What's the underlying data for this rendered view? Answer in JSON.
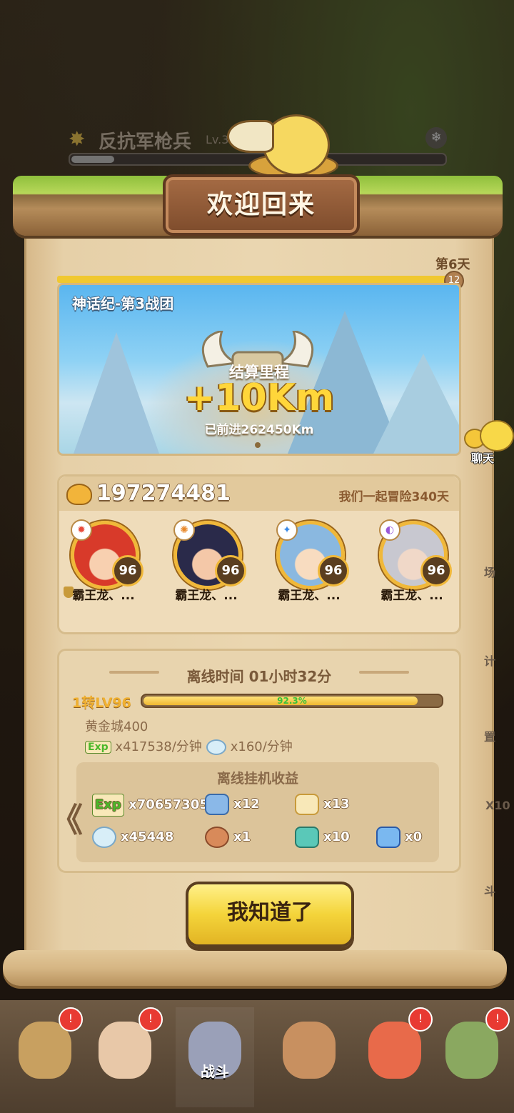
{
  "background": {
    "enemy_name": "反抗军枪兵",
    "enemy_level": "Lv.3",
    "snow_icon": "snowflake-icon"
  },
  "dialog": {
    "title": "欢迎回来",
    "stage_tag": "第6天",
    "stage_badge": "12",
    "map": {
      "title": "神话纪-第3战团",
      "settle_label": "结算里程",
      "gain": "+10Km",
      "advanced": "已前进262450Km"
    },
    "team": {
      "power": "197274481",
      "days": "我们一起冒险340天",
      "heroes": [
        {
          "name": "霸王龙、...",
          "level": "96",
          "element_color": "#e84a3a",
          "hair": "#d83a2a",
          "skin": "#f8d0b0",
          "element_icon": "fire-element-icon"
        },
        {
          "name": "霸王龙、...",
          "level": "96",
          "element_color": "#e8882a",
          "hair": "#2a2a4a",
          "skin": "#f4c8a8",
          "element_icon": "fire-element-icon"
        },
        {
          "name": "霸王龙、...",
          "level": "96",
          "element_color": "#3a8ae8",
          "hair": "#8ab8e0",
          "skin": "#f8dcc0",
          "element_icon": "ice-element-icon"
        },
        {
          "name": "霸王龙、...",
          "level": "96",
          "element_color": "#9a5ad8",
          "hair": "#c8c8d0",
          "skin": "#f0d8c8",
          "element_icon": "shadow-element-icon"
        }
      ]
    },
    "offline": {
      "time_text": "离线时间 01小时32分",
      "level_label": "1转LV96",
      "xp_percent": "92.3%",
      "xp_fraction": 0.923,
      "city": "黄金城400",
      "exp_tag": "Exp",
      "exp_rate": "x417538/分钟",
      "gem_rate": "x160/分钟",
      "rewards_title": "离线挂机收益",
      "rewards": [
        {
          "icon": "exp-icon",
          "amount": "x70657305"
        },
        {
          "icon": "equipment-box-icon",
          "amount": "x12"
        },
        {
          "icon": "torch-icon",
          "amount": "x13"
        },
        {
          "icon": "diamond-icon",
          "amount": "x45448"
        },
        {
          "icon": "meat-icon",
          "amount": "x1"
        },
        {
          "icon": "green-stone-icon",
          "amount": "x10"
        },
        {
          "icon": "blue-crystal-icon",
          "amount": "x0"
        }
      ],
      "prev_arrow": "《"
    },
    "confirm_label": "我知道了"
  },
  "side": {
    "chat_label": "聊天",
    "frag1": "场",
    "frag2": "计",
    "frag3": "置",
    "frag4": "X10",
    "frag5": "斗"
  },
  "nav": {
    "tabs": [
      {
        "label": "",
        "color": "#c8a060",
        "alert": true
      },
      {
        "label": "",
        "color": "#e8c8a8",
        "alert": true
      },
      {
        "label": "战斗",
        "color": "#9aa0b8",
        "alert": false
      },
      {
        "label": "",
        "color": "#c89060",
        "alert": false
      },
      {
        "label": "",
        "color": "#e86a4a",
        "alert": true
      },
      {
        "label": "",
        "color": "#8aa860",
        "alert": true
      }
    ],
    "alert_glyph": "!"
  }
}
